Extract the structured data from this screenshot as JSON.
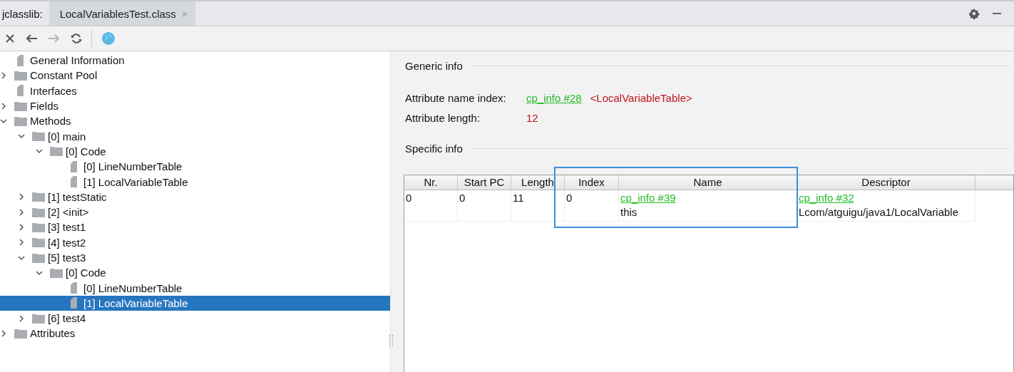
{
  "tabs": {
    "label": "jclasslib:",
    "items": [
      {
        "label": "LocalVariablesTest.class",
        "selected": true,
        "close": "×"
      }
    ]
  },
  "toolbar": [
    {
      "kind": "close",
      "disabled": false
    },
    {
      "kind": "back",
      "disabled": false
    },
    {
      "kind": "forward",
      "disabled": true
    },
    {
      "kind": "refresh",
      "disabled": false
    },
    {
      "kind": "web",
      "disabled": false
    }
  ],
  "tree": [
    {
      "label": "General Information",
      "kind": "file",
      "selected": false
    },
    {
      "label": "Constant Pool",
      "kind": "folder",
      "expanded": false,
      "selected": false
    },
    {
      "label": "Interfaces",
      "kind": "file",
      "selected": false
    },
    {
      "label": "Fields",
      "kind": "folder",
      "expanded": false,
      "selected": false
    },
    {
      "label": "Methods",
      "kind": "folder",
      "expanded": true,
      "selected": false,
      "children": [
        {
          "label": "[0] main",
          "kind": "folder",
          "expanded": true,
          "selected": false,
          "children": [
            {
              "label": "[0] Code",
              "kind": "folder",
              "expanded": true,
              "selected": false,
              "children": [
                {
                  "label": "[0] LineNumberTable",
                  "kind": "file",
                  "selected": false
                },
                {
                  "label": "[1] LocalVariableTable",
                  "kind": "file",
                  "selected": false
                }
              ]
            }
          ]
        },
        {
          "label": "[1] testStatic",
          "kind": "folder",
          "expanded": false,
          "selected": false
        },
        {
          "label": "[2] <init>",
          "kind": "folder",
          "expanded": false,
          "selected": false
        },
        {
          "label": "[3] test1",
          "kind": "folder",
          "expanded": false,
          "selected": false
        },
        {
          "label": "[4] test2",
          "kind": "folder",
          "expanded": false,
          "selected": false
        },
        {
          "label": "[5] test3",
          "kind": "folder",
          "expanded": true,
          "selected": false,
          "children": [
            {
              "label": "[0] Code",
              "kind": "folder",
              "expanded": true,
              "selected": false,
              "children": [
                {
                  "label": "[0] LineNumberTable",
                  "kind": "file",
                  "selected": false
                },
                {
                  "label": "[1] LocalVariableTable",
                  "kind": "file",
                  "selected": true
                }
              ]
            }
          ]
        },
        {
          "label": "[6] test4",
          "kind": "folder",
          "expanded": false,
          "selected": false
        }
      ]
    },
    {
      "label": "Attributes",
      "kind": "folder",
      "expanded": false,
      "selected": false
    }
  ],
  "generic_info": {
    "title": "Generic info",
    "fields": [
      {
        "label": "Attribute name index:",
        "link": "cp_info #28",
        "value": "<LocalVariableTable>"
      },
      {
        "label": "Attribute length:",
        "value": "12"
      }
    ]
  },
  "specific_info": {
    "title": "Specific info",
    "table": {
      "columns": [
        "Nr.",
        "Start PC",
        "Length",
        "Index",
        "Name",
        "Descriptor"
      ],
      "rows": [
        {
          "cells": [
            {
              "text": "0"
            },
            {
              "text": "0"
            },
            {
              "text": "11"
            },
            {
              "text": "0"
            },
            {
              "link": "cp_info #39",
              "text": "this"
            },
            {
              "link": "cp_info #32",
              "text": "Lcom/atguigu/java1/LocalVariable"
            }
          ]
        }
      ]
    }
  }
}
